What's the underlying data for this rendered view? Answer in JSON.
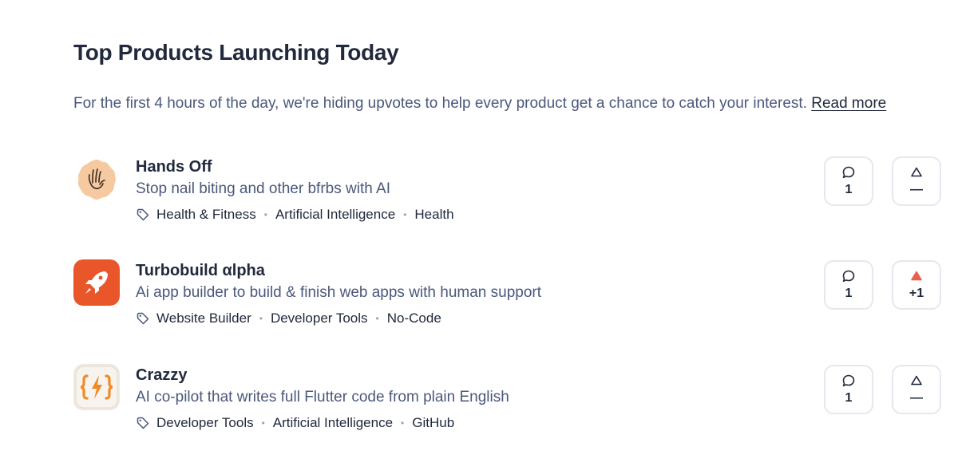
{
  "header": {
    "title": "Top Products Launching Today",
    "notice": "For the first 4 hours of the day, we're hiding upvotes to help every product get a chance to catch your interest.",
    "read_more": "Read more"
  },
  "products": [
    {
      "name": "Hands Off",
      "tagline": "Stop nail biting and other bfrbs with AI",
      "topics": [
        "Health & Fitness",
        "Artificial Intelligence",
        "Health"
      ],
      "comments": "1",
      "upvotes": "—",
      "upvoted": false,
      "thumb_icon": "hand-icon",
      "thumb_color": "#f6c9a0"
    },
    {
      "name": "Turbobuild αlpha",
      "tagline": "Ai app builder to build & finish web apps with human support",
      "topics": [
        "Website Builder",
        "Developer Tools",
        "No-Code"
      ],
      "comments": "1",
      "upvotes": "+1",
      "upvoted": true,
      "thumb_icon": "rocket-icon",
      "thumb_color": "#e8562a"
    },
    {
      "name": "Crazzy",
      "tagline": "AI co-pilot that writes full Flutter code from plain English",
      "topics": [
        "Developer Tools",
        "Artificial Intelligence",
        "GitHub"
      ],
      "comments": "1",
      "upvotes": "—",
      "upvoted": false,
      "thumb_icon": "code-bolt-icon",
      "thumb_color": "#f08a24"
    }
  ],
  "colors": {
    "upvoted": "#e8604c",
    "text_primary": "#21293c",
    "text_secondary": "#4b587c",
    "border": "#e5e8ee"
  }
}
